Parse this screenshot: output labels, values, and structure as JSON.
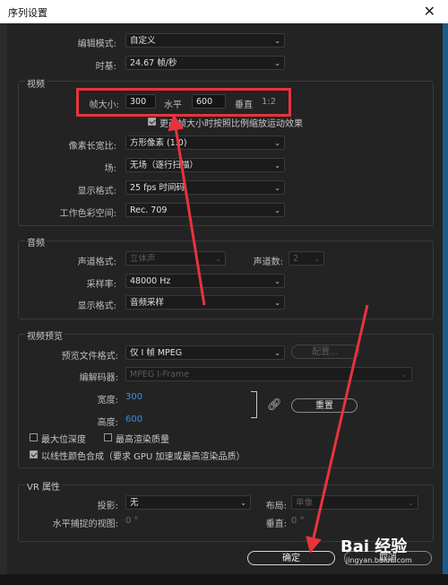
{
  "window": {
    "title": "序列设置",
    "close_glyph": "✕"
  },
  "top": {
    "editing_mode_label": "编辑模式:",
    "editing_mode_value": "自定义",
    "timebase_label": "时基:",
    "timebase_value": "24.67  帧/秒"
  },
  "video": {
    "title": "视频",
    "frame_size_label": "帧大小:",
    "width_value": "300",
    "horizontal_label": "水平",
    "height_value": "600",
    "vertical_label": "垂直",
    "ratio": "1:2",
    "scale_checkbox_label": "更改帧大小时按照比例缩放运动效果",
    "pixel_aspect_label": "像素长宽比:",
    "pixel_aspect_value": "方形像素 (1.0)",
    "field_label": "场:",
    "field_value": "无场（逐行扫描）",
    "display_format_label": "显示格式:",
    "display_format_value": "25 fps 时间码",
    "color_space_label": "工作色彩空间:",
    "color_space_value": "Rec. 709"
  },
  "audio": {
    "title": "音频",
    "channel_format_label": "声道格式:",
    "channel_format_value": "立体声",
    "channel_count_label": "声道数:",
    "channel_count_value": "2",
    "sample_rate_label": "采样率:",
    "sample_rate_value": "48000 Hz",
    "display_format_label": "显示格式:",
    "display_format_value": "音频采样"
  },
  "preview": {
    "title": "视频预览",
    "file_format_label": "预览文件格式:",
    "file_format_value": "仅 I 帧 MPEG",
    "config_button": "配置...",
    "codec_label": "编解码器:",
    "codec_value": "MPEG I-Frame",
    "width_label": "宽度:",
    "width_value": "300",
    "height_label": "高度:",
    "height_value": "600",
    "reset_button": "重置",
    "max_depth_label": "最大位深度",
    "max_quality_label": "最高渲染质量",
    "linear_color_label": "以线性颜色合成（要求 GPU 加速或最高渲染品质）"
  },
  "vr": {
    "title": "VR 属性",
    "projection_label": "投影:",
    "projection_value": "无",
    "layout_label": "布局:",
    "layout_value": "单像",
    "h_fov_label": "水平捕捉的视图:",
    "h_fov_value": "0 °",
    "vertical_label": "垂直:",
    "vertical_value": "0 °"
  },
  "footer": {
    "ok_button": "确定",
    "cancel_button": "取消"
  },
  "watermark": {
    "brand": "Bai 经验",
    "url": "jingyan.baidu.com"
  },
  "checkbox_states": {
    "scale": true,
    "max_depth": false,
    "max_quality": false,
    "linear": true
  },
  "annotation_color": "#e8333d"
}
